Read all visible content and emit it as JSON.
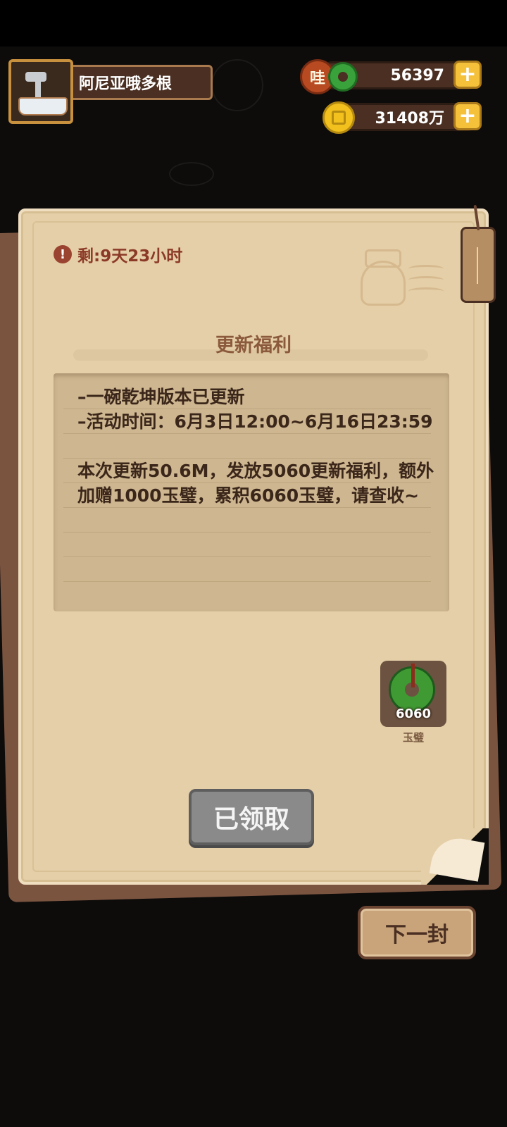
{
  "player": {
    "name": "阿尼亚哦多根"
  },
  "currencies": {
    "jade": {
      "icon_label": "哇",
      "value": "56397"
    },
    "coins": {
      "value": "31408万"
    }
  },
  "letter": {
    "timer": "剩:9天23小时",
    "title": "更新福利",
    "body": "–一碗乾坤版本已更新\n–活动时间：6月3日12:00~6月16日23:59\n\n本次更新50.6M，发放5060更新福利，额外加赠1000玉璧，累积6060玉璧，请查收~",
    "reward": {
      "name": "玉璧",
      "count": "6060"
    },
    "claim_button": "已领取"
  },
  "next_button": "下一封",
  "icons": {
    "avatar": "bathtub-avatar",
    "jade": "jade-disc-icon",
    "coin": "coin-icon",
    "plus": "plus-icon",
    "timer": "alert-icon",
    "stamp": "duck-stamp-icon",
    "tag": "bookmark-tag-icon"
  },
  "colors": {
    "background": "#0d0c0b",
    "paper": "#e5cfa8",
    "title": "#8b5a3c",
    "timer": "#8b3a28",
    "claim_disabled": "#8a8a8a"
  }
}
